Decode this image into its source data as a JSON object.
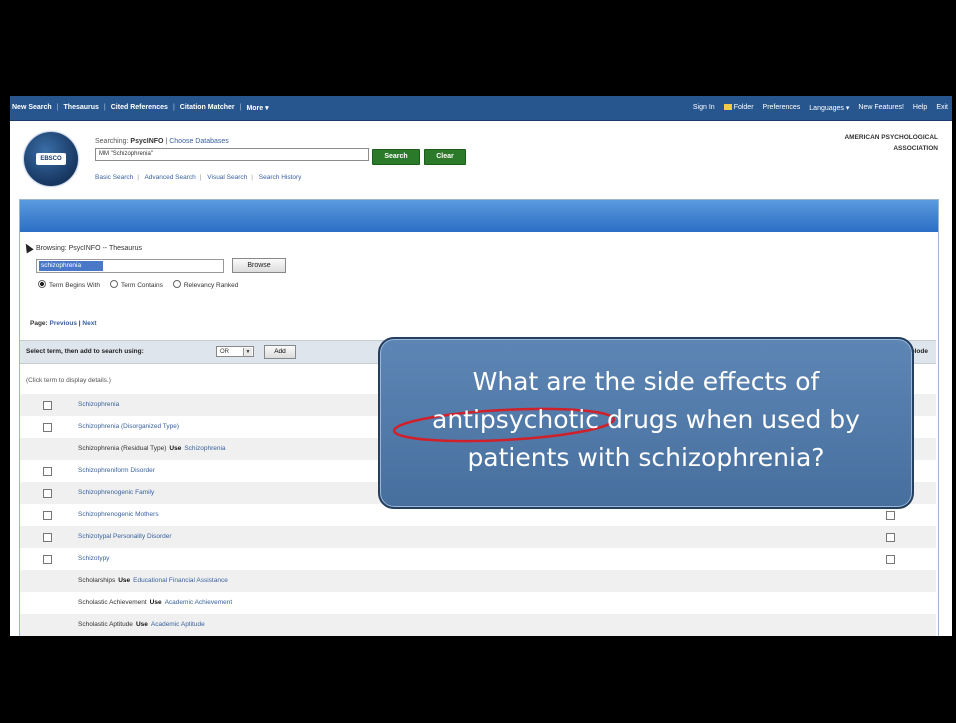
{
  "topnav": {
    "left": [
      "New Search",
      "Thesaurus",
      "Cited References",
      "Citation Matcher",
      "More ▾"
    ],
    "right": [
      "Sign In",
      "Folder",
      "Preferences",
      "Languages ▾",
      "New Features!",
      "Help",
      "Exit"
    ]
  },
  "logo": {
    "text": "EBSCO",
    "icon": "ebsco-logo"
  },
  "search": {
    "searching_label": "Searching:",
    "database": "PsycINFO",
    "choose_db": "Choose Databases",
    "query": "MM \"Schizophrenia\"",
    "search_button": "Search",
    "clear_button": "Clear",
    "links": [
      "Basic Search",
      "Advanced Search",
      "Visual Search",
      "Search History"
    ]
  },
  "publisher": {
    "line1": "AMERICAN PSYCHOLOGICAL",
    "line2": "ASSOCIATION"
  },
  "browse": {
    "title": "Browsing: PsycINFO -- Thesaurus",
    "input_value": "schizophrenia",
    "browse_button": "Browse",
    "options": [
      "Term Begins With",
      "Term Contains",
      "Relevancy Ranked"
    ],
    "selected_option": "Term Begins With"
  },
  "pager": {
    "label": "Page:",
    "previous": "Previous",
    "next": "Next"
  },
  "select_bar": {
    "instruction": "Select term, then add to search using:",
    "operator": "OR",
    "add_button": "Add",
    "explode_label": "Explode"
  },
  "click_hint": "(Click term to display details.)",
  "terms": [
    {
      "label": "Schizophrenia",
      "left_cb": true,
      "right_cb": false,
      "link": true
    },
    {
      "label": "Schizophrenia (Disorganized Type)",
      "left_cb": true,
      "right_cb": true,
      "link": true
    },
    {
      "label": "Schizophrenia (Residual Type)",
      "use": "Use",
      "target": "Schizophrenia",
      "left_cb": false,
      "right_cb": false,
      "link": false
    },
    {
      "label": "Schizophreniform Disorder",
      "left_cb": true,
      "right_cb": true,
      "link": true
    },
    {
      "label": "Schizophrenogenic Family",
      "left_cb": true,
      "right_cb": true,
      "link": true
    },
    {
      "label": "Schizophrenogenic Mothers",
      "left_cb": true,
      "right_cb": true,
      "link": true
    },
    {
      "label": "Schizotypal Personality Disorder",
      "left_cb": true,
      "right_cb": true,
      "link": true
    },
    {
      "label": "Schizotypy",
      "left_cb": true,
      "right_cb": true,
      "link": true
    },
    {
      "label": "Scholarships",
      "use": "Use",
      "target": "Educational Financial Assistance",
      "left_cb": false,
      "right_cb": false,
      "link": false
    },
    {
      "label": "Scholastic Achievement",
      "use": "Use",
      "target": "Academic Achievement",
      "left_cb": false,
      "right_cb": false,
      "link": false
    },
    {
      "label": "Scholastic Aptitude",
      "use": "Use",
      "target": "Academic Aptitude",
      "left_cb": false,
      "right_cb": false,
      "link": false
    }
  ],
  "callout": {
    "line1": "What are the side effects of",
    "line2": "antipsychotic drugs when used by",
    "line3": "patients with schizophrenia?",
    "highlight_color": "#d0202a",
    "fill_color": "#5a80ae"
  }
}
